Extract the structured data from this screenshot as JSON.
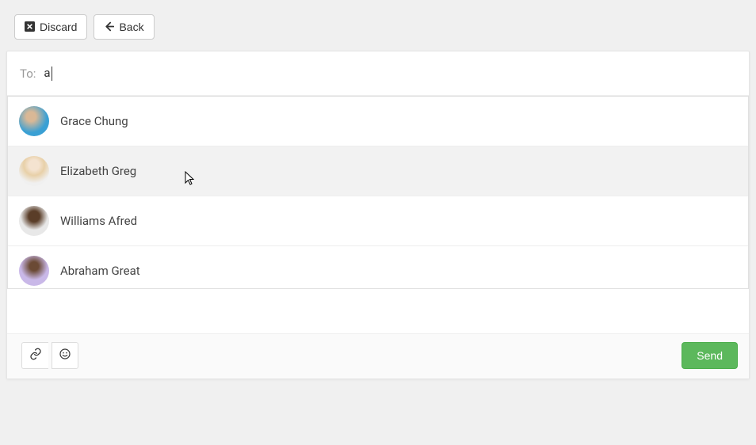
{
  "toolbar": {
    "discard_label": "Discard",
    "back_label": "Back"
  },
  "compose": {
    "to_label": "To:",
    "to_value": "a"
  },
  "suggestions": [
    {
      "name": "Grace Chung",
      "avatar": "av1",
      "hover": false
    },
    {
      "name": "Elizabeth Greg",
      "avatar": "av2",
      "hover": true
    },
    {
      "name": "Williams Afred",
      "avatar": "av3",
      "hover": false
    },
    {
      "name": "Abraham Great",
      "avatar": "av4",
      "hover": false
    }
  ],
  "footer": {
    "send_label": "Send"
  }
}
